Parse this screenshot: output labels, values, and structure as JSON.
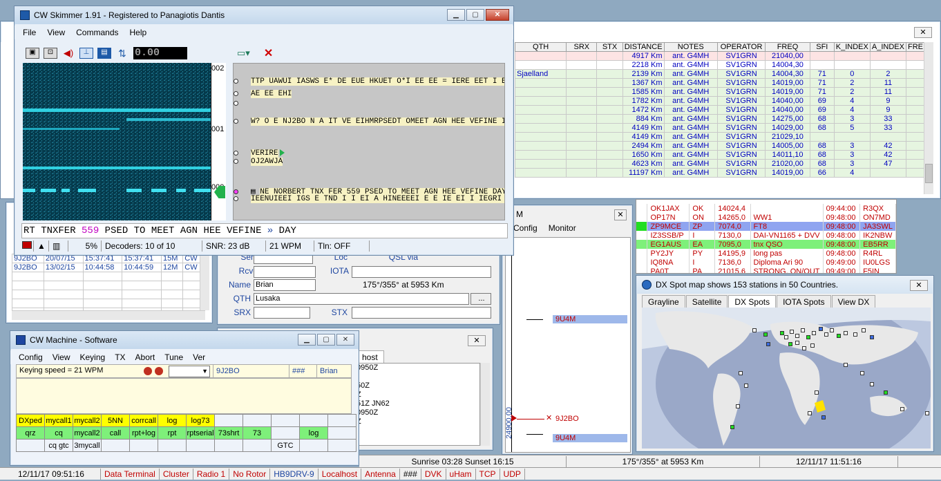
{
  "skimmer": {
    "title": "CW Skimmer 1.91 - Registered to Panagiotis Dantis",
    "menu": [
      "File",
      "View",
      "Commands",
      "Help"
    ],
    "freq_readout": "0.00",
    "scale_labels": [
      "002",
      "001",
      "000"
    ],
    "decodes": [
      "TTP UAWUI IASWS E* DE EUE HKUET O*I EE EE = IERE EET I E E E E",
      "AE EE EHI",
      "",
      "W? O E NJ2BO N A IT VE EIHMRPSEDT OMEET AGN HEE VEFINE IA E",
      "VERIRE",
      "OJ2AWJA",
      "NE NORBERT TNX FER 559 PSED TO MEET AGN HEE VEFINE DAY",
      "IEENUIEEI IGS E TND I I EI A HINEEEEI E E IE EI I IEGRI NIEE M ST E"
    ],
    "tape_pre": "RT TNXFER ",
    "tape_rst": "559",
    "tape_post": " PSED TO MEET AGN HEE VEFINE ",
    "tape_arrow": "»",
    "tape_end": " DAY",
    "status": {
      "volume": "5%",
      "decoders": "Decoders: 10 of 10",
      "snr": "SNR: 23 dB",
      "wpm": "21 WPM",
      "tln": "Tln: OFF"
    }
  },
  "log": {
    "headers": [
      "QTH",
      "SRX",
      "STX",
      "DISTANCE",
      "NOTES",
      "OPERATOR",
      "FREQ",
      "SFI",
      "K_INDEX",
      "A_INDEX",
      "FRE"
    ],
    "rows": [
      [
        "",
        "",
        "",
        "4917 Km",
        "ant. G4MH",
        "SV1GRN",
        "21040,00",
        "",
        "",
        ""
      ],
      [
        "",
        "",
        "",
        "2218 Km",
        "ant. G4MH",
        "SV1GRN",
        "14004,30",
        "",
        "",
        ""
      ],
      [
        "Sjaelland",
        "",
        "",
        "2139 Km",
        "ant. G4MH",
        "SV1GRN",
        "14004,30",
        "71",
        "0",
        "2"
      ],
      [
        "",
        "",
        "",
        "1367 Km",
        "ant. G4MH",
        "SV1GRN",
        "14019,00",
        "71",
        "2",
        "11"
      ],
      [
        "",
        "",
        "",
        "1585 Km",
        "ant. G4MH",
        "SV1GRN",
        "14019,00",
        "71",
        "2",
        "11"
      ],
      [
        "",
        "",
        "",
        "1782 Km",
        "ant. G4MH",
        "SV1GRN",
        "14040,00",
        "69",
        "4",
        "9"
      ],
      [
        "",
        "",
        "",
        "1472 Km",
        "ant. G4MH",
        "SV1GRN",
        "14040,00",
        "69",
        "4",
        "9"
      ],
      [
        "",
        "",
        "",
        "884 Km",
        "ant. G4MH",
        "SV1GRN",
        "14275,00",
        "68",
        "3",
        "33"
      ],
      [
        "",
        "",
        "",
        "4149 Km",
        "ant. G4MH",
        "SV1GRN",
        "14029,00",
        "68",
        "5",
        "33"
      ],
      [
        "",
        "",
        "",
        "4149 Km",
        "ant. G4MH",
        "SV1GRN",
        "21029,10",
        "",
        "",
        ""
      ],
      [
        "",
        "",
        "",
        "2494 Km",
        "ant. G4MH",
        "SV1GRN",
        "14005,00",
        "68",
        "3",
        "42"
      ],
      [
        "",
        "",
        "",
        "1650 Km",
        "ant. G4MH",
        "SV1GRN",
        "14011,10",
        "68",
        "3",
        "42"
      ],
      [
        "",
        "",
        "",
        "4623 Km",
        "ant. G4MH",
        "SV1GRN",
        "21020,00",
        "68",
        "3",
        "47"
      ],
      [
        "",
        "",
        "",
        "11197 Km",
        "ant. G4MH",
        "SV1GRN",
        "14019,00",
        "66",
        "4",
        ""
      ]
    ]
  },
  "recent": {
    "rows": [
      [
        "9J2BO",
        "20/07/15",
        "15:37:41",
        "15:37:41",
        "15M",
        "CW"
      ],
      [
        "9J2BO",
        "13/02/15",
        "10:44:58",
        "10:44:59",
        "12M",
        "CW"
      ]
    ]
  },
  "entry": {
    "sent_label": "Sent",
    "loc_label": "Loc",
    "qsl_label": "QSL via",
    "rcvd_label": "Rcvd",
    "iota_label": "IOTA",
    "name_label": "Name",
    "name_value": "Brian",
    "bearing": "175°/355° at 5953 Km",
    "qth_label": "QTH",
    "qth_value": "Lusaka",
    "more_label": "...",
    "srx_label": "SRX",
    "stx_label": "STX"
  },
  "cluster_left": {
    "tab": "host",
    "lines": [
      "0950Z",
      "",
      "50Z",
      "Z",
      "51Z JN62",
      "0950Z",
      "Z"
    ]
  },
  "bandmap": {
    "title": "M",
    "menu": [
      "Config",
      "Monitor"
    ],
    "spots": [
      "9U4M",
      "9J2BO",
      "9U4M"
    ],
    "freq_label": "24900,00"
  },
  "spots": {
    "rows": [
      [
        "OK1JAX",
        "OK",
        "14024,4",
        "",
        "09:44:00",
        "R3QX",
        ""
      ],
      [
        "OP17N",
        "ON",
        "14265,0",
        "WW1",
        "09:48:00",
        "ON7MD",
        ""
      ],
      [
        "ZP9MCE",
        "ZP",
        "7074,0",
        "FT8",
        "09:48:00",
        "JA3SWL",
        "blue"
      ],
      [
        "IZ3SSB/P",
        "I",
        "7130,0",
        "DAI-VN1165 + DVV",
        "09:48:00",
        "IK2NBW",
        ""
      ],
      [
        "EG1AUS",
        "EA",
        "7095,0",
        "tnx QSO",
        "09:48:00",
        "EB5RR",
        "green"
      ],
      [
        "PY2JY",
        "PY",
        "14195,9",
        "long pas",
        "09:48:00",
        "R4RL",
        ""
      ],
      [
        "IQ8NA",
        "I",
        "7136,0",
        "Diploma Ari 90",
        "09:49:00",
        "IU0LGS",
        ""
      ],
      [
        "PA0T",
        "PA",
        "21015,6",
        "STRONG, ON/OUT",
        "09:49:00",
        "F5IN",
        ""
      ]
    ]
  },
  "map": {
    "title": "DX Spot map shows 153 stations in 50 Countries.",
    "tabs": [
      "Grayline",
      "Satellite",
      "DX Spots",
      "IOTA Spots",
      "View DX"
    ],
    "active_tab": "DX Spots"
  },
  "cwmachine": {
    "title": "CW Machine - Software",
    "menu": [
      "Config",
      "View",
      "Keying",
      "TX",
      "Abort",
      "Tune",
      "Ver"
    ],
    "speed": "Keying speed = 21 WPM",
    "call": "9J2BO",
    "rst": "###",
    "name": "Brian",
    "row1": [
      "DXped",
      "mycall1",
      "mycall2",
      "5NN",
      "corrcall",
      "log",
      "log73",
      "",
      "",
      "",
      "",
      ""
    ],
    "row2": [
      "qrz",
      "cq",
      "mycall2",
      "call",
      "rpt+log",
      "rpt",
      "rptserial",
      "73shrt",
      "73",
      "",
      "log",
      ""
    ],
    "row3": [
      "",
      "cq gtc",
      "3mycall",
      "",
      "",
      "",
      "",
      "",
      "",
      "GTC",
      "",
      ""
    ]
  },
  "sunbar": {
    "sun": "Sunrise 03:28 Sunset 16:15",
    "bearing": "175°/355° at 5953 Km",
    "datetime": "12/11/17   11:51:16"
  },
  "statusbar": {
    "datetime": "12/11/17  09:51:16",
    "items": [
      "Data Terminal",
      "Cluster",
      "Radio 1",
      "No Rotor",
      "HB9DRV-9",
      "Localhost",
      "Antenna",
      "###",
      "DVK",
      "uHam",
      "TCP",
      "UDP"
    ]
  },
  "colors": {
    "red_text": "#c00000",
    "blue_text": "#0000c0",
    "yellow": "#ffff00",
    "green": "#7ef07a"
  }
}
